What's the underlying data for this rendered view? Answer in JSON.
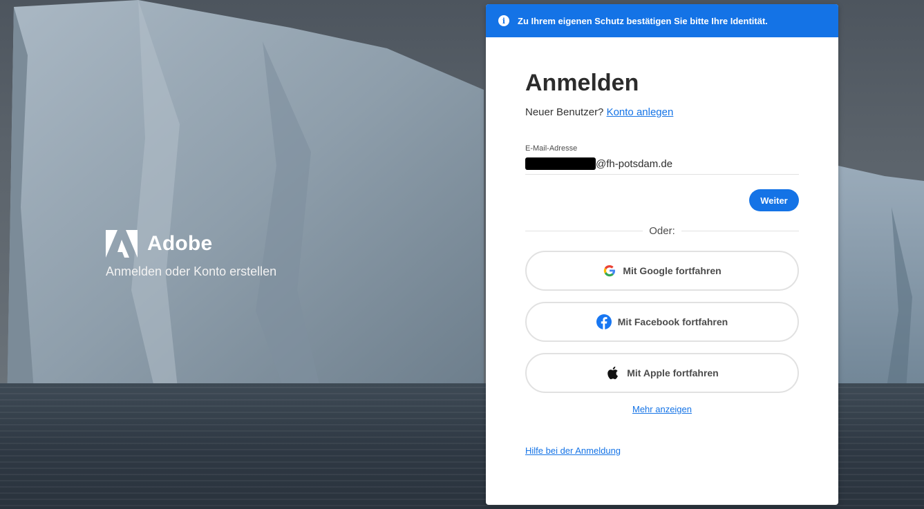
{
  "brand": {
    "name": "Adobe",
    "subtitle": "Anmelden oder Konto erstellen"
  },
  "banner": {
    "icon": "info-icon",
    "text": "Zu Ihrem eigenen Schutz bestätigen Sie bitte Ihre Identität."
  },
  "signin": {
    "title": "Anmelden",
    "new_user_prompt": "Neuer Benutzer?",
    "create_account_link": "Konto anlegen",
    "email_label": "E-Mail-Adresse",
    "email_value_visible": "@fh-potsdam.de",
    "continue_button": "Weiter",
    "or_label": "Oder:",
    "social_buttons": [
      {
        "label": "Mit Google fortfahren",
        "icon": "google-icon"
      },
      {
        "label": "Mit Facebook fortfahren",
        "icon": "facebook-icon"
      },
      {
        "label": "Mit Apple fortfahren",
        "icon": "apple-icon"
      }
    ],
    "show_more_link": "Mehr anzeigen",
    "help_link": "Hilfe bei der Anmeldung"
  },
  "colors": {
    "accent": "#1473e6",
    "facebook": "#1877f2"
  }
}
